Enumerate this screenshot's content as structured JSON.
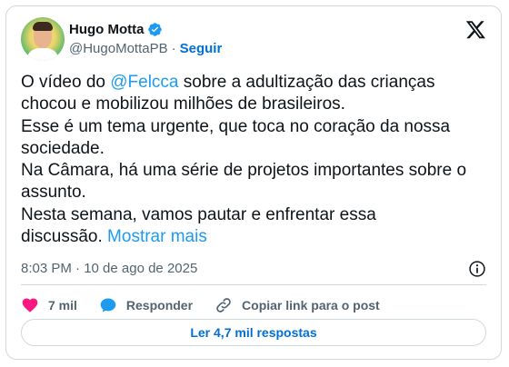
{
  "author": {
    "name": "Hugo Motta",
    "handle": "@HugoMottaPB",
    "separator": "·",
    "follow_label": "Seguir"
  },
  "tweet": {
    "text_before_mention": "O vídeo do ",
    "mention": "@Felcca",
    "text_after_mention": " sobre a adultização das crianças\nchocou e mobilizou milhões de brasileiros.\nEsse é um tema urgente, que toca no coração da nossa\nsociedade.\nNa Câmara, há uma série de projetos importantes sobre o\nassunto.\nNesta semana, vamos pautar e enfrentar essa\ndiscussão. ",
    "show_more": "Mostrar mais"
  },
  "meta": {
    "time": "8:03 PM · 10 de ago de 2025"
  },
  "actions": {
    "likes_count": "7 mil",
    "reply_label": "Responder",
    "copy_link_label": "Copiar link para o post"
  },
  "replies_button": "Ler 4,7 mil respostas",
  "icons": {
    "verified": "verified-badge-icon",
    "logo": "x-logo-icon",
    "info": "info-icon",
    "like": "heart-icon",
    "reply": "reply-bubble-icon",
    "link": "link-icon"
  },
  "colors": {
    "accent": "#1d9bf0",
    "link_bold": "#006fd6",
    "like": "#f91880",
    "secondary_text": "#536471",
    "border": "#cfd9de"
  }
}
